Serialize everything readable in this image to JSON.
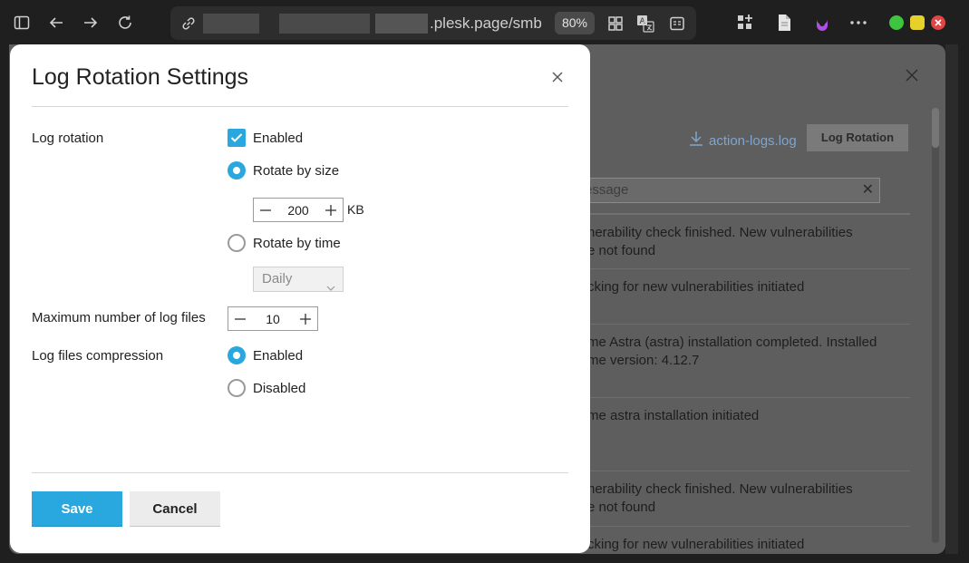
{
  "browser": {
    "url_visible": ".plesk.page/smb",
    "zoom": "80%",
    "colors": {
      "minimize": "#3ec43e",
      "maximize": "#e6d12a",
      "close": "#e04646"
    }
  },
  "background": {
    "download_link": "action-logs.log",
    "log_rotation_button": "Log Rotation",
    "search_placeholder": "essage",
    "rows": [
      {
        "line1": "nerability check finished. New vulnerabilities",
        "line2": "e not found"
      },
      {
        "line1": "cking for new vulnerabilities initiated",
        "line2": ""
      },
      {
        "line1": "me Astra (astra) installation completed. Installed",
        "line2": "me version: 4.12.7"
      },
      {
        "line1": "me astra installation initiated",
        "line2": ""
      },
      {
        "line1": "nerability check finished. New vulnerabilities",
        "line2": "e not found"
      },
      {
        "line1": "cking for new vulnerabilities initiated",
        "line2": ""
      }
    ]
  },
  "modal": {
    "title": "Log Rotation Settings",
    "log_rotation": {
      "label": "Log rotation",
      "enabled_label": "Enabled",
      "enabled_checked": true,
      "by_size_label": "Rotate by size",
      "by_size_selected": true,
      "size_value": "200",
      "size_unit": "KB",
      "by_time_label": "Rotate by time",
      "by_time_selected": false,
      "time_value": "Daily"
    },
    "max_files": {
      "label": "Maximum number of log files",
      "value": "10"
    },
    "compression": {
      "label": "Log files compression",
      "enabled_label": "Enabled",
      "disabled_label": "Disabled",
      "selected": "Enabled"
    },
    "save_label": "Save",
    "cancel_label": "Cancel",
    "accent_color": "#28a8df"
  }
}
